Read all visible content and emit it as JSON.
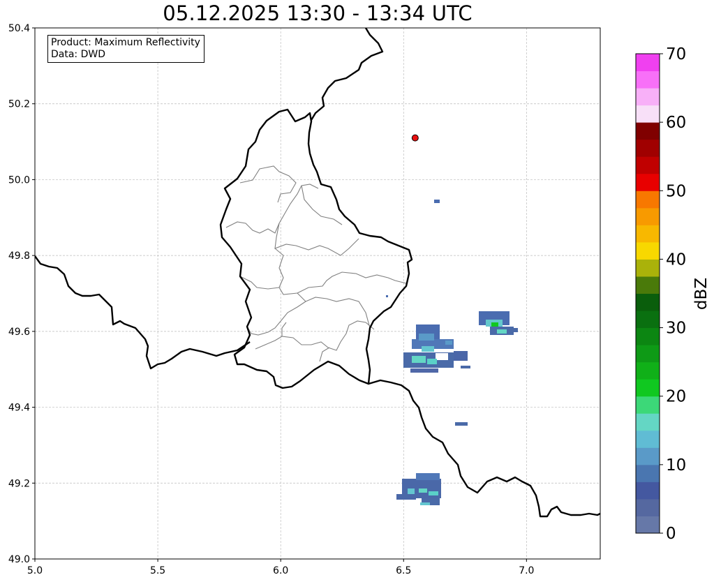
{
  "title": "05.12.2025 13:30 - 13:34 UTC",
  "info": {
    "product": "Product: Maximum Reflectivity",
    "data": "Data: DWD"
  },
  "map": {
    "lon_range": [
      5.0,
      7.3
    ],
    "lat_range": [
      49.0,
      50.4
    ],
    "x_ticks": [
      "5.0",
      "5.5",
      "6.0",
      "6.5",
      "7.0"
    ],
    "y_ticks": [
      "49.0",
      "49.2",
      "49.4",
      "49.6",
      "49.8",
      "50.0",
      "50.2",
      "50.4"
    ],
    "grid": "dashed",
    "border_color": "#000000",
    "canton_color": "#808080",
    "marker": {
      "lon": 6.547,
      "lat": 50.11,
      "color": "#e81010"
    }
  },
  "colorbar": {
    "label": "dBZ",
    "ticks": [
      "0",
      "10",
      "20",
      "30",
      "40",
      "50",
      "60",
      "70"
    ],
    "range": [
      0,
      70
    ],
    "colors": [
      "#6678a8",
      "#5568a0",
      "#4458a0",
      "#4a76b0",
      "#5a9ac8",
      "#60bcd4",
      "#64d6c4",
      "#3cd878",
      "#10c820",
      "#10b018",
      "#0e9a16",
      "#0c8612",
      "#0a7010",
      "#0a5e0c",
      "#4a7a0a",
      "#aab20a",
      "#f8d800",
      "#f8b800",
      "#f89a00",
      "#f87800",
      "#e80000",
      "#c00000",
      "#a00000",
      "#800000",
      "#f8e0f8",
      "#f8b0f8",
      "#f870f8",
      "#f040f0"
    ]
  }
}
